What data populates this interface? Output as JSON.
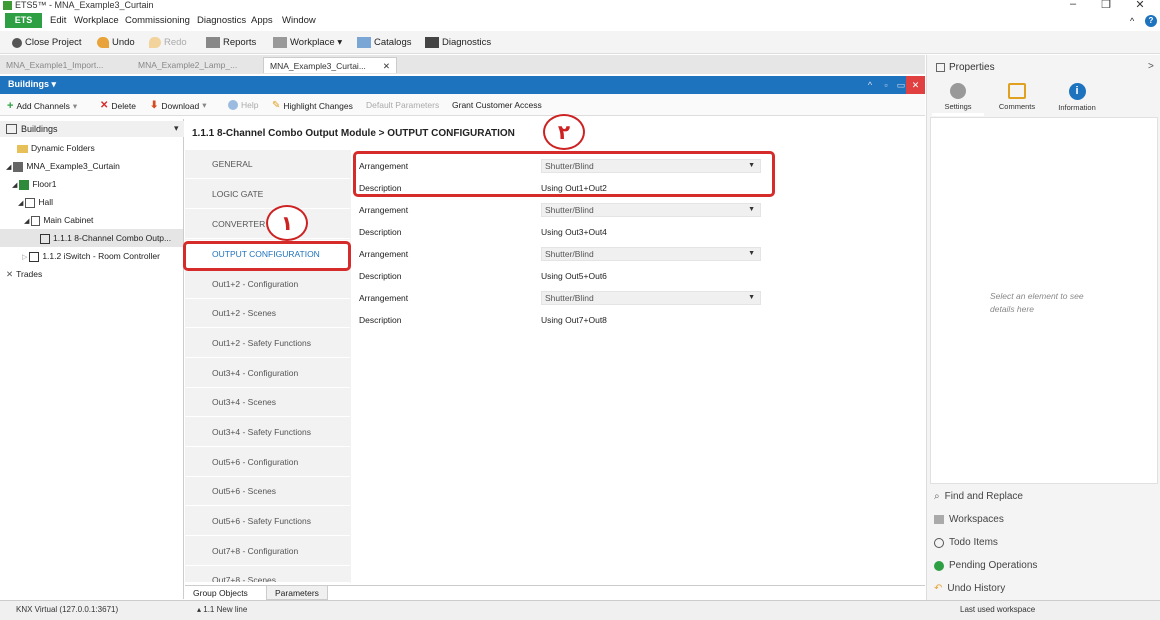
{
  "window": {
    "title": "ETS5™ - MNA_Example3_Curtain",
    "controls": [
      "–",
      "❐",
      "✕"
    ],
    "right_icons": [
      "^",
      "?"
    ]
  },
  "menu": {
    "ets": "ETS",
    "items": [
      "Edit",
      "Workplace",
      "Commissioning",
      "Diagnostics",
      "Apps",
      "Window"
    ]
  },
  "toolbar": {
    "close_project": "Close Project",
    "undo": "Undo",
    "redo": "Redo",
    "reports": "Reports",
    "workplace": "Workplace ▾",
    "catalogs": "Catalogs",
    "diagnostics": "Diagnostics"
  },
  "doc_tabs": [
    "MNA_Example1_Import...",
    "MNA_Example2_Lamp_...",
    "MNA_Example3_Curtai..."
  ],
  "doc_tab_close": "✕",
  "panel": {
    "title": "Buildings ▾",
    "btns": [
      "^",
      "▫",
      "▭",
      "✕"
    ]
  },
  "subtoolbar": {
    "add_channels": "Add Channels",
    "delete": "Delete",
    "download": "Download",
    "help": "Help",
    "highlight_changes": "Highlight Changes",
    "default_parameters": "Default Parameters",
    "grant_customer_access": "Grant Customer Access"
  },
  "tree": {
    "header": "Buildings",
    "nodes": [
      "Dynamic Folders",
      "MNA_Example3_Curtain",
      "Floor1",
      "Hall",
      "Main Cabinet",
      "1.1.1 8-Channel Combo Outp...",
      "1.1.2 iSwitch - Room Controller",
      "Trades"
    ]
  },
  "breadcrumb": "1.1.1 8-Channel Combo Output Module > OUTPUT CONFIGURATION",
  "nav": [
    "GENERAL",
    "LOGIC GATE",
    "CONVERTER",
    "OUTPUT CONFIGURATION",
    "Out1+2 - Configuration",
    "Out1+2 - Scenes",
    "Out1+2 - Safety Functions",
    "Out3+4 - Configuration",
    "Out3+4 - Scenes",
    "Out3+4 - Safety Functions",
    "Out5+6 - Configuration",
    "Out5+6 - Scenes",
    "Out5+6 - Safety Functions",
    "Out7+8 - Configuration",
    "Out7+8 - Scenes"
  ],
  "params": [
    {
      "arr_label": "Arrangement",
      "arr_value": "Shutter/Blind",
      "desc_label": "Description",
      "desc_value": "Using Out1+Out2"
    },
    {
      "arr_label": "Arrangement",
      "arr_value": "Shutter/Blind",
      "desc_label": "Description",
      "desc_value": "Using Out3+Out4"
    },
    {
      "arr_label": "Arrangement",
      "arr_value": "Shutter/Blind",
      "desc_label": "Description",
      "desc_value": "Using Out5+Out6"
    },
    {
      "arr_label": "Arrangement",
      "arr_value": "Shutter/Blind",
      "desc_label": "Description",
      "desc_value": "Using Out7+Out8"
    }
  ],
  "annotations": {
    "marker1": "١",
    "marker2": "٢"
  },
  "bottom_tabs": [
    "Group Objects",
    "Parameters"
  ],
  "properties": {
    "title": "Properties",
    "chevron": ">",
    "tabs": [
      "Settings",
      "Comments",
      "Information"
    ],
    "empty_text": "Select an element to see details here",
    "links": [
      "Find and Replace",
      "Workspaces",
      "Todo Items",
      "Pending Operations",
      "Undo History"
    ]
  },
  "status": {
    "connection": "KNX Virtual  (127.0.0.1:3671)",
    "new_line": "1.1 New line",
    "workspace": "Last used workspace"
  }
}
